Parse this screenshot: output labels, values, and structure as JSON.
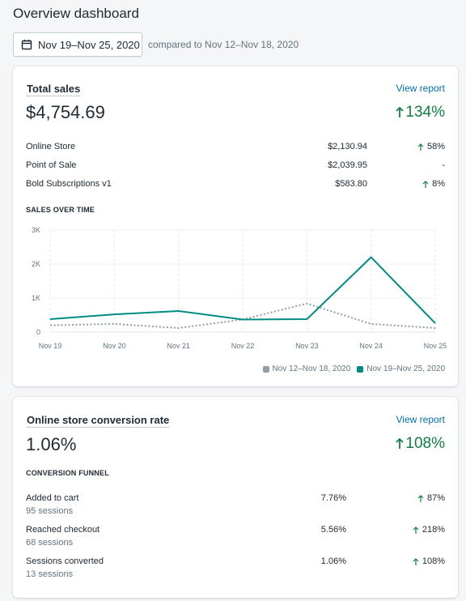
{
  "page": {
    "title": "Overview dashboard"
  },
  "date_range": {
    "label": "Nov 19–Nov 25, 2020",
    "compare_text": "compared to Nov 12–Nov 18, 2020"
  },
  "total_sales": {
    "title": "Total sales",
    "view_report": "View report",
    "amount": "$4,754.69",
    "change": "134%",
    "rows": [
      {
        "label": "Online Store",
        "value": "$2,130.94",
        "change": "58%",
        "up": true
      },
      {
        "label": "Point of Sale",
        "value": "$2,039.95",
        "change": "-",
        "up": false
      },
      {
        "label": "Bold Subscriptions v1",
        "value": "$583.80",
        "change": "8%",
        "up": true
      }
    ],
    "chart_label": "SALES OVER TIME"
  },
  "chart_data": {
    "type": "line",
    "categories": [
      "Nov 19",
      "Nov 20",
      "Nov 21",
      "Nov 22",
      "Nov 23",
      "Nov 24",
      "Nov 25"
    ],
    "y_ticks": [
      "3K",
      "2K",
      "1K",
      "0"
    ],
    "ylim": [
      0,
      3000
    ],
    "grid": true,
    "legend_position": "bottom-right",
    "series": [
      {
        "name": "Nov 12–Nov 18, 2020",
        "color": "#919eab",
        "style": "dotted",
        "values": [
          200,
          240,
          120,
          370,
          840,
          240,
          120
        ]
      },
      {
        "name": "Nov 19–Nov 25, 2020",
        "color": "#008c83",
        "style": "solid",
        "values": [
          380,
          520,
          620,
          370,
          380,
          2200,
          260
        ]
      }
    ]
  },
  "conversion": {
    "title": "Online store conversion rate",
    "view_report": "View report",
    "rate": "1.06%",
    "change": "108%",
    "funnel_label": "CONVERSION FUNNEL",
    "rows": [
      {
        "label": "Added to cart",
        "sessions": "95 sessions",
        "value": "7.76%",
        "change": "87%"
      },
      {
        "label": "Reached checkout",
        "sessions": "68 sessions",
        "value": "5.56%",
        "change": "218%"
      },
      {
        "label": "Sessions converted",
        "sessions": "13 sessions",
        "value": "1.06%",
        "change": "108%"
      }
    ]
  },
  "colors": {
    "positive": "#108043",
    "link": "#006fbb",
    "series_current": "#008c83",
    "series_previous": "#919eab"
  }
}
